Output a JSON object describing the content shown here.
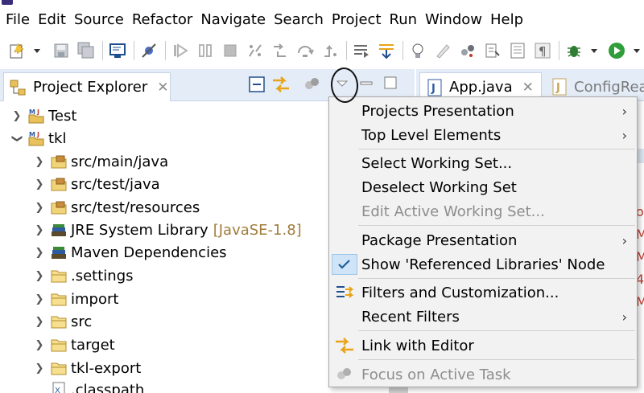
{
  "menubar": {
    "items": [
      "File",
      "Edit",
      "Source",
      "Refactor",
      "Navigate",
      "Search",
      "Project",
      "Run",
      "Window",
      "Help"
    ]
  },
  "toolbar": {
    "icons": [
      "new-icon",
      "save-icon",
      "save-all-icon",
      "terminal-icon",
      "skip-breakpoints-icon",
      "resume-icon",
      "suspend-icon",
      "terminate-icon",
      "disconnect-icon",
      "step-into-icon",
      "step-over-icon",
      "step-return-icon",
      "drop-to-frame-icon",
      "use-step-filters-icon",
      "tip-icon",
      "mark-occurrences-icon",
      "git-icon",
      "annotation-icon",
      "block-selection-icon",
      "show-whitespace-icon",
      "debug-icon",
      "run-icon"
    ]
  },
  "explorer": {
    "tab_label": "Project Explorer",
    "tree": [
      {
        "label": "Test",
        "expanded": false,
        "level": 0,
        "icon": "maven-project-icon"
      },
      {
        "label": "tkl",
        "expanded": true,
        "level": 0,
        "icon": "maven-project-icon"
      },
      {
        "label": "src/main/java",
        "level": 1,
        "icon": "source-folder-icon"
      },
      {
        "label": "src/test/java",
        "level": 1,
        "icon": "source-folder-icon"
      },
      {
        "label": "src/test/resources",
        "level": 1,
        "icon": "source-folder-icon"
      },
      {
        "label": "JRE System Library",
        "decoration": "[JavaSE-1.8]",
        "level": 1,
        "icon": "library-icon"
      },
      {
        "label": "Maven Dependencies",
        "level": 1,
        "icon": "library-icon"
      },
      {
        "label": ".settings",
        "level": 1,
        "icon": "folder-icon"
      },
      {
        "label": "import",
        "level": 1,
        "icon": "folder-icon"
      },
      {
        "label": "src",
        "level": 1,
        "icon": "folder-icon"
      },
      {
        "label": "target",
        "level": 1,
        "icon": "folder-icon"
      },
      {
        "label": "tkl-export",
        "level": 1,
        "icon": "folder-icon"
      },
      {
        "label": ".classpath",
        "level": 1,
        "icon": "xml-file-icon"
      }
    ]
  },
  "editor": {
    "tabs": [
      {
        "label": "App.java",
        "active": true
      },
      {
        "label": "ConfigRea",
        "active": false
      }
    ],
    "edge_text": [
      "o",
      "M",
      "",
      "M",
      "4",
      "M"
    ]
  },
  "view_menu": {
    "items": [
      {
        "label": "Projects Presentation",
        "submenu": true
      },
      {
        "label": "Top Level Elements",
        "submenu": true
      },
      {
        "label": "Select Working Set...",
        "submenu": false
      },
      {
        "label": "Deselect Working Set",
        "submenu": false
      },
      {
        "label": "Edit Active Working Set...",
        "submenu": false,
        "disabled": true
      },
      {
        "label": "Package Presentation",
        "submenu": true
      },
      {
        "label": "Show 'Referenced Libraries' Node",
        "checked": true
      },
      {
        "label": "Filters and Customization...",
        "icon": "filters-icon"
      },
      {
        "label": "Recent Filters",
        "submenu": true
      },
      {
        "label": "Link with Editor",
        "icon": "link-icon"
      },
      {
        "label": "Focus on Active Task",
        "icon": "task-icon",
        "disabled": true
      }
    ]
  },
  "colors": {
    "tab_bar": "#e4ecf7",
    "menu_bg": "#f2f2f2",
    "decoration": "#a07c3a",
    "run_green": "#2e9d3a"
  }
}
